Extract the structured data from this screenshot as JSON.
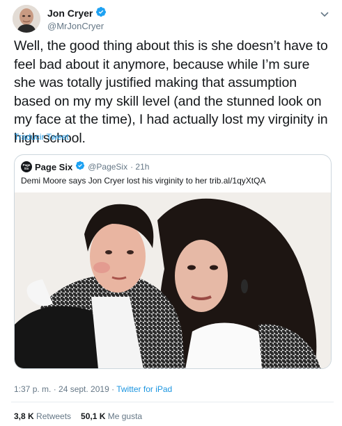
{
  "author": {
    "name": "Jon Cryer",
    "handle": "@MrJonCryer"
  },
  "tweet": {
    "text": "Well, the good thing about this is she doesn’t have to feel bad about it anymore, because while I’m sure she was totally justified making that assumption based on my my skill level (and the stunned look on my face at the time), I had actually lost my virginity in high school.",
    "translate_label": "Traducir Tweet"
  },
  "quoted_tweet": {
    "avatar_text": "Page Six",
    "name": "Page Six",
    "handle": "@PageSix",
    "time": "· 21h",
    "text": "Demi Moore says Jon Cryer lost his virginity to her trib.al/1qyXtQA"
  },
  "meta": {
    "time": "1:37 p. m. · 24 sept. 2019 · ",
    "source": "Twitter for iPad"
  },
  "stats": {
    "retweets_count": "3,8 K",
    "retweets_label": " Retweets",
    "likes_count": "50,1 K",
    "likes_label": " Me gusta"
  },
  "colors": {
    "link": "#1b95e0",
    "verified": "#1da1f2",
    "secondary_text": "#657786"
  }
}
